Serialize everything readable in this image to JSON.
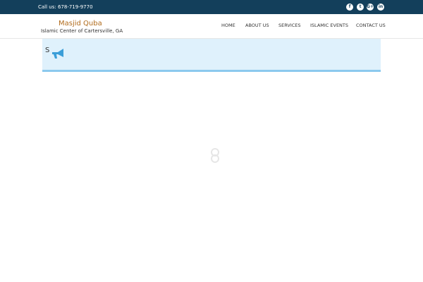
{
  "topbar": {
    "call_text": "Call us: 678-719-9770",
    "social": [
      {
        "icon": "facebook-icon",
        "glyph": "f"
      },
      {
        "icon": "twitter-icon",
        "glyph": "t"
      },
      {
        "icon": "google-plus-icon",
        "glyph": "G+"
      },
      {
        "icon": "linkedin-icon",
        "glyph": "in"
      }
    ]
  },
  "brand": {
    "title": "Masjid Quba",
    "subtitle": "Islamic Center of Cartersville, GA"
  },
  "nav": {
    "items": [
      "HOME",
      "ABOUT US",
      "SERVICES",
      "ISLAMIC EVENTS",
      "CONTACT US"
    ]
  },
  "notice": {
    "letter": "S",
    "icon": "megaphone-icon"
  },
  "loader": {
    "icon": "loading-spinner-icon"
  },
  "colors": {
    "topbar": "#133f5b",
    "brand": "#b16c1d",
    "notice_bg": "#dff1fc",
    "notice_border": "#8cc9ee",
    "megaphone": "#3b9ed8"
  }
}
